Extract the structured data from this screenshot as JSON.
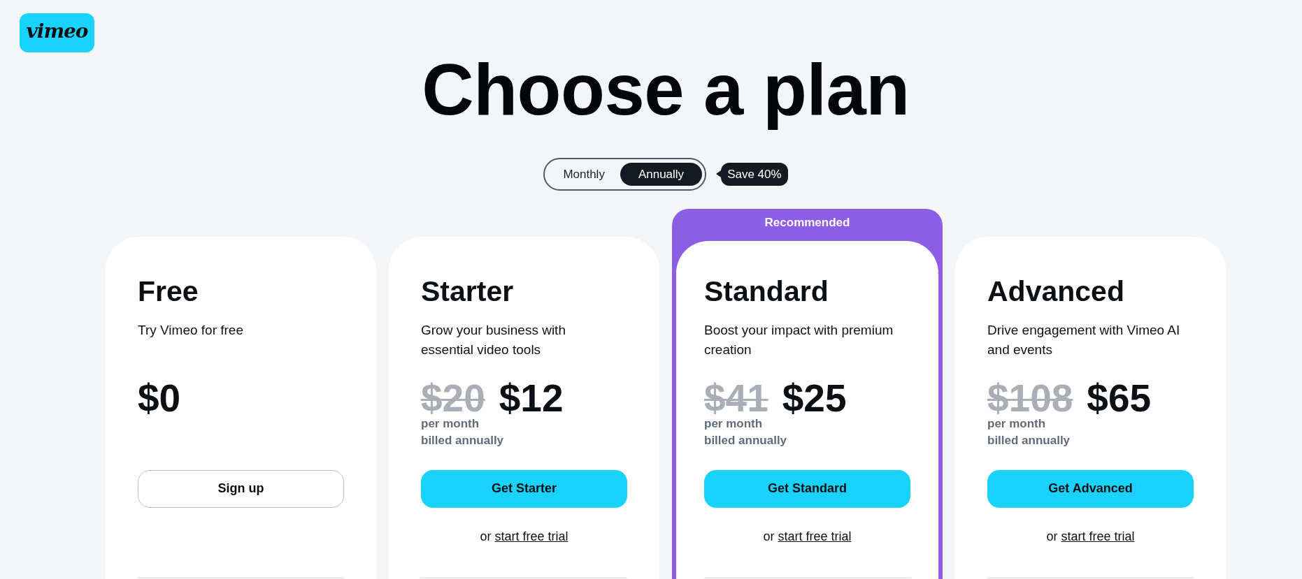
{
  "logo": {
    "text": "vimeo"
  },
  "title": "Choose a plan",
  "billing_toggle": {
    "options": [
      {
        "label": "Monthly",
        "selected": false
      },
      {
        "label": "Annually",
        "selected": true
      }
    ],
    "badge": "Save 40%"
  },
  "plans": [
    {
      "name": "Free",
      "recommended": false,
      "description": "Try Vimeo for free",
      "price": "$0",
      "button": {
        "label": "Sign up",
        "kind": "outline"
      }
    },
    {
      "name": "Starter",
      "recommended": false,
      "description": "Grow your business with essential video tools",
      "original_price": "$20",
      "price": "$12",
      "billing": [
        "per month",
        "billed annually"
      ],
      "button": {
        "label": "Get Starter",
        "kind": "primary"
      },
      "trial": {
        "prefix": "or",
        "link": "start free trial"
      }
    },
    {
      "name": "Standard",
      "recommended": true,
      "recommended_label": "Recommended",
      "description": "Boost your impact with premium creation",
      "original_price": "$41",
      "price": "$25",
      "billing": [
        "per month",
        "billed annually"
      ],
      "button": {
        "label": "Get Standard",
        "kind": "primary"
      },
      "trial": {
        "prefix": "or",
        "link": "start free trial"
      }
    },
    {
      "name": "Advanced",
      "recommended": false,
      "description": "Drive engagement with Vimeo AI and events",
      "original_price": "$108",
      "price": "$65",
      "billing": [
        "per month",
        "billed annually"
      ],
      "button": {
        "label": "Get Advanced",
        "kind": "primary"
      },
      "trial": {
        "prefix": "or",
        "link": "start free trial"
      }
    }
  ]
}
